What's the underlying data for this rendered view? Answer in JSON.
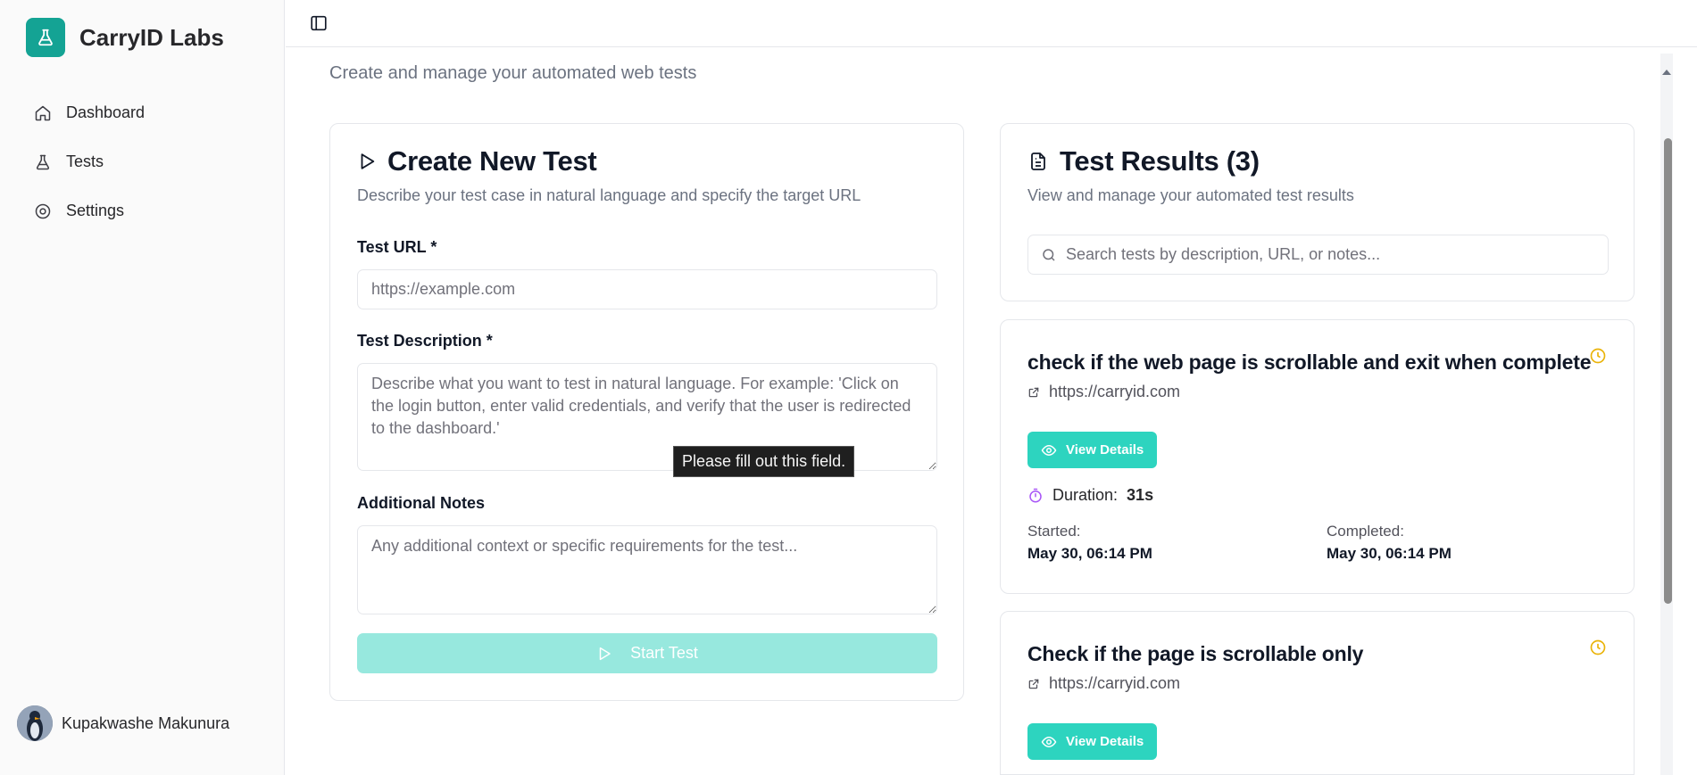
{
  "brand": {
    "name": "CarryID Labs"
  },
  "sidebar": {
    "items": [
      {
        "label": "Dashboard",
        "icon": "home-icon"
      },
      {
        "label": "Tests",
        "icon": "flask-icon"
      },
      {
        "label": "Settings",
        "icon": "settings-icon"
      }
    ],
    "user": {
      "name": "Kupakwashe Makunura"
    }
  },
  "page": {
    "subtitle": "Create and manage your automated web tests"
  },
  "create": {
    "title": "Create New Test",
    "description": "Describe your test case in natural language and specify the target URL",
    "url_label": "Test URL *",
    "url_placeholder": "https://example.com",
    "desc_label": "Test Description *",
    "desc_placeholder": "Describe what you want to test in natural language. For example: 'Click on the login button, enter valid credentials, and verify that the user is redirected to the dashboard.'",
    "notes_label": "Additional Notes",
    "notes_placeholder": "Any additional context or specific requirements for the test...",
    "start_label": "Start Test",
    "tooltip": "Please fill out this field."
  },
  "results": {
    "title": "Test Results (3)",
    "description": "View and manage your automated test results",
    "search_placeholder": "Search tests by description, URL, or notes...",
    "items": [
      {
        "title": "check if the web page is scrollable and exit when complete",
        "url": "https://carryid.com",
        "view_label": "View Details",
        "duration_label": "Duration:",
        "duration": "31s",
        "started_label": "Started:",
        "started": "May 30, 06:14 PM",
        "completed_label": "Completed:",
        "completed": "May 30, 06:14 PM"
      },
      {
        "title": "Check if the page is scrollable only",
        "url": "https://carryid.com",
        "view_label": "View Details"
      }
    ]
  },
  "colors": {
    "brand": "#14a394",
    "accent": "#2dd4bf",
    "accent_disabled": "#97e8de",
    "pending": "#eab308",
    "duration_icon": "#a855f7"
  }
}
